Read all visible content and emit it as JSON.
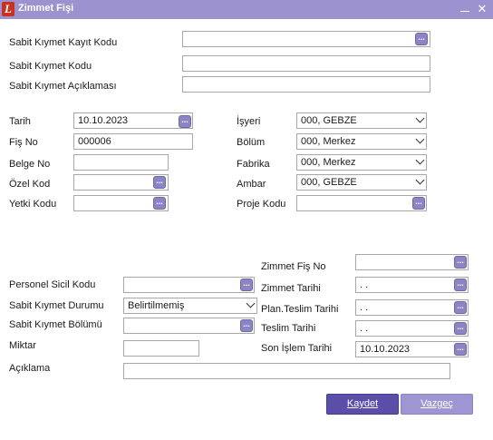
{
  "window": {
    "title": "Zimmet Fişi",
    "logo_text": "L"
  },
  "labels": {
    "kayit_kodu": "Sabit Kıymet Kayıt Kodu",
    "kiymet_kodu": "Sabit Kıymet Kodu",
    "kiymet_aciklama": "Sabit Kıymet Açıklaması",
    "tarih": "Tarih",
    "fis_no": "Fiş No",
    "belge_no": "Belge No",
    "ozel_kod": "Özel Kod",
    "yetki_kodu": "Yetki Kodu",
    "isyeri": "İşyeri",
    "bolum": "Bölüm",
    "fabrika": "Fabrika",
    "ambar": "Ambar",
    "proje_kodu": "Proje Kodu",
    "zimmet_fis_no": "Zimmet Fiş No",
    "zimmet_tarihi": "Zimmet Tarihi",
    "plan_teslim": "Plan.Teslim Tarihi",
    "teslim_tarihi": "Teslim Tarihi",
    "son_islem": "Son İşlem Tarihi",
    "personel_sicil": "Personel Sicil Kodu",
    "kiymet_durumu": "Sabit Kıymet Durumu",
    "kiymet_bolumu": "Sabit Kıymet Bölümü",
    "miktar": "Miktar",
    "aciklama": "Açıklama"
  },
  "values": {
    "tarih": "10.10.2023",
    "fis_no": "000006",
    "isyeri": "000, GEBZE",
    "bolum": "000, Merkez",
    "fabrika": "000, Merkez",
    "ambar": "000, GEBZE",
    "zimmet_tarihi": " . .",
    "plan_teslim": " . .",
    "teslim_tarihi": " . .",
    "son_islem": "10.10.2023",
    "kiymet_durumu": "Belirtilmemiş"
  },
  "lookup_glyph": "...",
  "buttons": {
    "save": "Kaydet",
    "cancel": "Vazgeç"
  },
  "colors": {
    "titlebar": "#9b92cf",
    "save": "#5a4ea8",
    "cancel": "#9d96d2",
    "lookup": "#8c84c4"
  }
}
